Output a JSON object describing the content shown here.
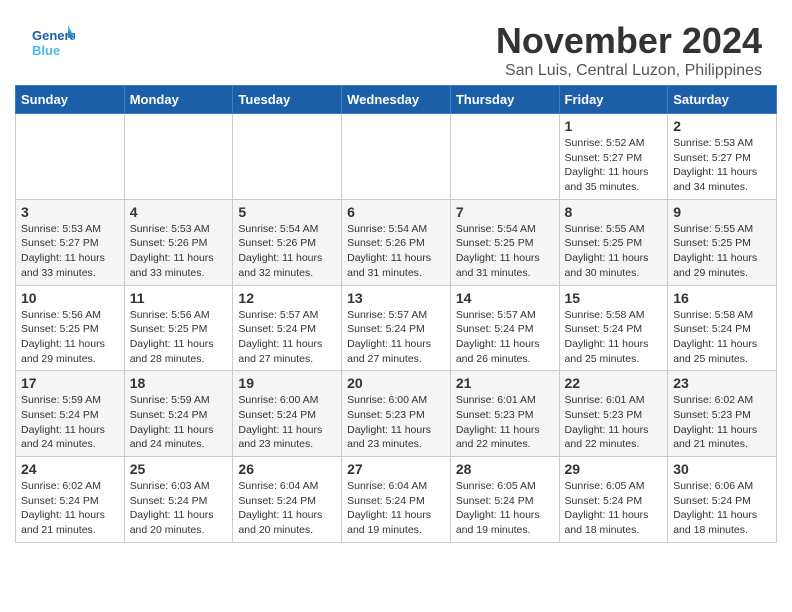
{
  "header": {
    "logo_text1": "General",
    "logo_text2": "Blue",
    "month": "November 2024",
    "location": "San Luis, Central Luzon, Philippines"
  },
  "columns": [
    "Sunday",
    "Monday",
    "Tuesday",
    "Wednesday",
    "Thursday",
    "Friday",
    "Saturday"
  ],
  "weeks": [
    [
      {
        "day": "",
        "info": ""
      },
      {
        "day": "",
        "info": ""
      },
      {
        "day": "",
        "info": ""
      },
      {
        "day": "",
        "info": ""
      },
      {
        "day": "",
        "info": ""
      },
      {
        "day": "1",
        "info": "Sunrise: 5:52 AM\nSunset: 5:27 PM\nDaylight: 11 hours\nand 35 minutes."
      },
      {
        "day": "2",
        "info": "Sunrise: 5:53 AM\nSunset: 5:27 PM\nDaylight: 11 hours\nand 34 minutes."
      }
    ],
    [
      {
        "day": "3",
        "info": "Sunrise: 5:53 AM\nSunset: 5:27 PM\nDaylight: 11 hours\nand 33 minutes."
      },
      {
        "day": "4",
        "info": "Sunrise: 5:53 AM\nSunset: 5:26 PM\nDaylight: 11 hours\nand 33 minutes."
      },
      {
        "day": "5",
        "info": "Sunrise: 5:54 AM\nSunset: 5:26 PM\nDaylight: 11 hours\nand 32 minutes."
      },
      {
        "day": "6",
        "info": "Sunrise: 5:54 AM\nSunset: 5:26 PM\nDaylight: 11 hours\nand 31 minutes."
      },
      {
        "day": "7",
        "info": "Sunrise: 5:54 AM\nSunset: 5:25 PM\nDaylight: 11 hours\nand 31 minutes."
      },
      {
        "day": "8",
        "info": "Sunrise: 5:55 AM\nSunset: 5:25 PM\nDaylight: 11 hours\nand 30 minutes."
      },
      {
        "day": "9",
        "info": "Sunrise: 5:55 AM\nSunset: 5:25 PM\nDaylight: 11 hours\nand 29 minutes."
      }
    ],
    [
      {
        "day": "10",
        "info": "Sunrise: 5:56 AM\nSunset: 5:25 PM\nDaylight: 11 hours\nand 29 minutes."
      },
      {
        "day": "11",
        "info": "Sunrise: 5:56 AM\nSunset: 5:25 PM\nDaylight: 11 hours\nand 28 minutes."
      },
      {
        "day": "12",
        "info": "Sunrise: 5:57 AM\nSunset: 5:24 PM\nDaylight: 11 hours\nand 27 minutes."
      },
      {
        "day": "13",
        "info": "Sunrise: 5:57 AM\nSunset: 5:24 PM\nDaylight: 11 hours\nand 27 minutes."
      },
      {
        "day": "14",
        "info": "Sunrise: 5:57 AM\nSunset: 5:24 PM\nDaylight: 11 hours\nand 26 minutes."
      },
      {
        "day": "15",
        "info": "Sunrise: 5:58 AM\nSunset: 5:24 PM\nDaylight: 11 hours\nand 25 minutes."
      },
      {
        "day": "16",
        "info": "Sunrise: 5:58 AM\nSunset: 5:24 PM\nDaylight: 11 hours\nand 25 minutes."
      }
    ],
    [
      {
        "day": "17",
        "info": "Sunrise: 5:59 AM\nSunset: 5:24 PM\nDaylight: 11 hours\nand 24 minutes."
      },
      {
        "day": "18",
        "info": "Sunrise: 5:59 AM\nSunset: 5:24 PM\nDaylight: 11 hours\nand 24 minutes."
      },
      {
        "day": "19",
        "info": "Sunrise: 6:00 AM\nSunset: 5:24 PM\nDaylight: 11 hours\nand 23 minutes."
      },
      {
        "day": "20",
        "info": "Sunrise: 6:00 AM\nSunset: 5:23 PM\nDaylight: 11 hours\nand 23 minutes."
      },
      {
        "day": "21",
        "info": "Sunrise: 6:01 AM\nSunset: 5:23 PM\nDaylight: 11 hours\nand 22 minutes."
      },
      {
        "day": "22",
        "info": "Sunrise: 6:01 AM\nSunset: 5:23 PM\nDaylight: 11 hours\nand 22 minutes."
      },
      {
        "day": "23",
        "info": "Sunrise: 6:02 AM\nSunset: 5:23 PM\nDaylight: 11 hours\nand 21 minutes."
      }
    ],
    [
      {
        "day": "24",
        "info": "Sunrise: 6:02 AM\nSunset: 5:24 PM\nDaylight: 11 hours\nand 21 minutes."
      },
      {
        "day": "25",
        "info": "Sunrise: 6:03 AM\nSunset: 5:24 PM\nDaylight: 11 hours\nand 20 minutes."
      },
      {
        "day": "26",
        "info": "Sunrise: 6:04 AM\nSunset: 5:24 PM\nDaylight: 11 hours\nand 20 minutes."
      },
      {
        "day": "27",
        "info": "Sunrise: 6:04 AM\nSunset: 5:24 PM\nDaylight: 11 hours\nand 19 minutes."
      },
      {
        "day": "28",
        "info": "Sunrise: 6:05 AM\nSunset: 5:24 PM\nDaylight: 11 hours\nand 19 minutes."
      },
      {
        "day": "29",
        "info": "Sunrise: 6:05 AM\nSunset: 5:24 PM\nDaylight: 11 hours\nand 18 minutes."
      },
      {
        "day": "30",
        "info": "Sunrise: 6:06 AM\nSunset: 5:24 PM\nDaylight: 11 hours\nand 18 minutes."
      }
    ]
  ]
}
